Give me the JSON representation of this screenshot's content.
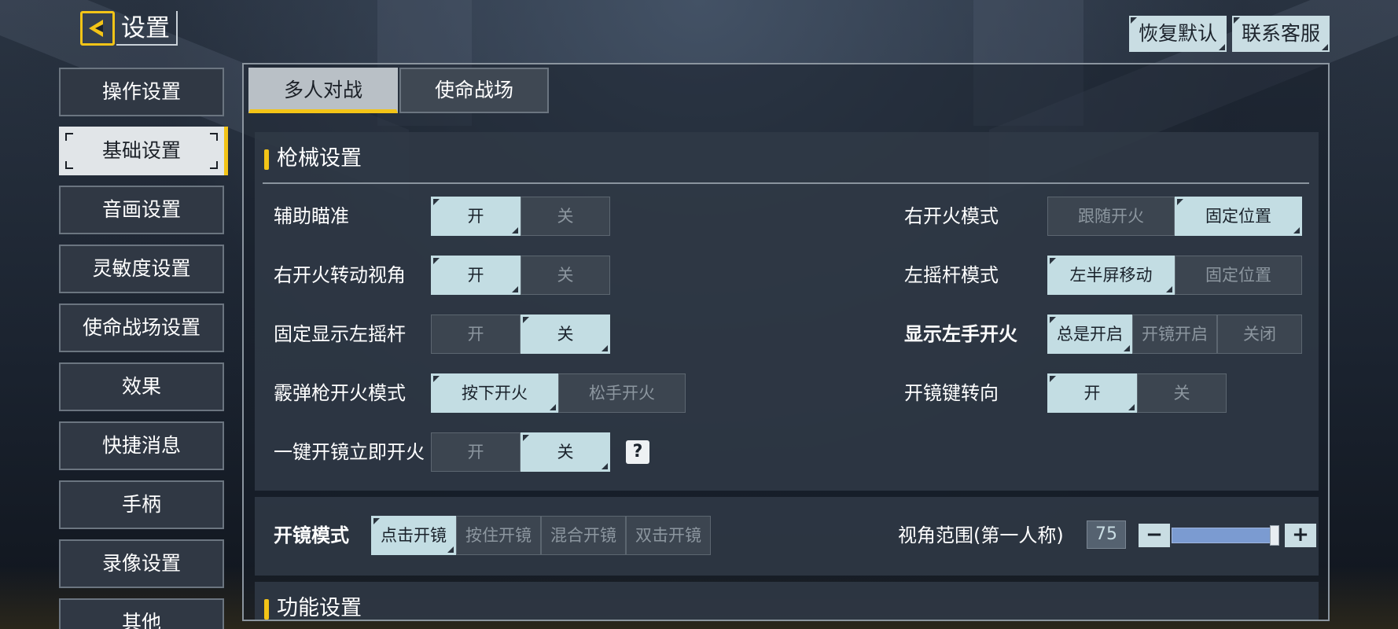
{
  "header": {
    "title": "设置",
    "reset_label": "恢复默认",
    "support_label": "联系客服"
  },
  "sidebar": {
    "items": [
      {
        "label": "操作设置"
      },
      {
        "label": "基础设置",
        "active": true
      },
      {
        "label": "音画设置"
      },
      {
        "label": "灵敏度设置"
      },
      {
        "label": "使命战场设置"
      },
      {
        "label": "效果"
      },
      {
        "label": "快捷消息"
      },
      {
        "label": "手柄"
      },
      {
        "label": "录像设置"
      },
      {
        "label": "其他"
      }
    ]
  },
  "tabs": [
    {
      "label": "多人对战",
      "active": true
    },
    {
      "label": "使命战场"
    }
  ],
  "weapon_section": {
    "title": "枪械设置",
    "left_rows": [
      {
        "label": "辅助瞄准",
        "options": [
          "开",
          "关"
        ],
        "selected": 0
      },
      {
        "label": "右开火转动视角",
        "options": [
          "开",
          "关"
        ],
        "selected": 0
      },
      {
        "label": "固定显示左摇杆",
        "options": [
          "开",
          "关"
        ],
        "selected": 1
      },
      {
        "label": "霰弹枪开火模式",
        "options": [
          "按下开火",
          "松手开火"
        ],
        "selected": 0
      },
      {
        "label": "一键开镜立即开火",
        "options": [
          "开",
          "关"
        ],
        "selected": 1
      }
    ],
    "right_rows": [
      {
        "label": "右开火模式",
        "options": [
          "跟随开火",
          "固定位置"
        ],
        "selected": 1
      },
      {
        "label": "左摇杆模式",
        "options": [
          "左半屏移动",
          "固定位置"
        ],
        "selected": 0
      },
      {
        "label": "显示左手开火",
        "options": [
          "总是开启",
          "开镜开启",
          "关闭"
        ],
        "selected": 0
      },
      {
        "label": "开镜键转向",
        "options": [
          "开",
          "关"
        ],
        "selected": 0
      }
    ],
    "help_glyph": "?"
  },
  "scope_section": {
    "label": "开镜模式",
    "options": [
      "点击开镜",
      "按住开镜",
      "混合开镜",
      "双击开镜"
    ],
    "selected": 0,
    "fov_label": "视角范围(第一人称)",
    "fov_value": "75",
    "fov_fraction": 0.98,
    "minus": "−",
    "plus": "+"
  },
  "function_section": {
    "title": "功能设置"
  },
  "colors": {
    "accent": "#f3c417",
    "selected_option": "#c3dde3",
    "slider": "#7b9bd1"
  },
  "icons": {
    "back": "back-arrow-icon",
    "help": "question-mark-icon"
  }
}
